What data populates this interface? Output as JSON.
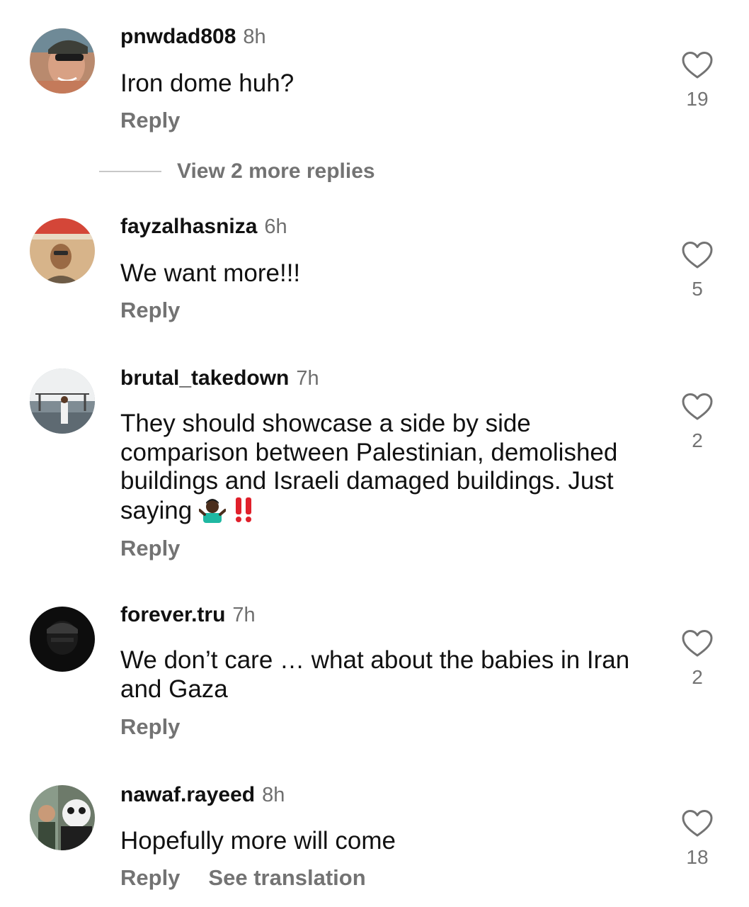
{
  "comments": [
    {
      "username": "pnwdad808",
      "time": "8h",
      "text": "Iron dome huh?",
      "likes": "19",
      "reply_label": "Reply"
    },
    {
      "username": "fayzalhasniza",
      "time": "6h",
      "text": "We want more!!!",
      "likes": "5",
      "reply_label": "Reply"
    },
    {
      "username": "brutal_takedown",
      "time": "7h",
      "text": "They should showcase a side by side comparison between Palestinian, demolished buildings and Israeli damaged buildings. Just saying",
      "emoji_suffix": [
        "person-shrugging-emoji",
        "double-exclamation-emoji"
      ],
      "likes": "2",
      "reply_label": "Reply"
    },
    {
      "username": "forever.tru",
      "time": "7h",
      "text": "We don’t care … what about the babies in Iran and Gaza",
      "likes": "2",
      "reply_label": "Reply"
    },
    {
      "username": "nawaf.rayeed",
      "time": "8h",
      "text": "Hopefully more will come",
      "likes": "18",
      "reply_label": "Reply",
      "see_translation_label": "See translation"
    }
  ],
  "view_more_replies": "View 2 more replies",
  "icons": {
    "like": "heart-outline-icon"
  },
  "colors": {
    "text": "#111111",
    "secondary": "#737373",
    "reaction_red": "#e0202b"
  }
}
